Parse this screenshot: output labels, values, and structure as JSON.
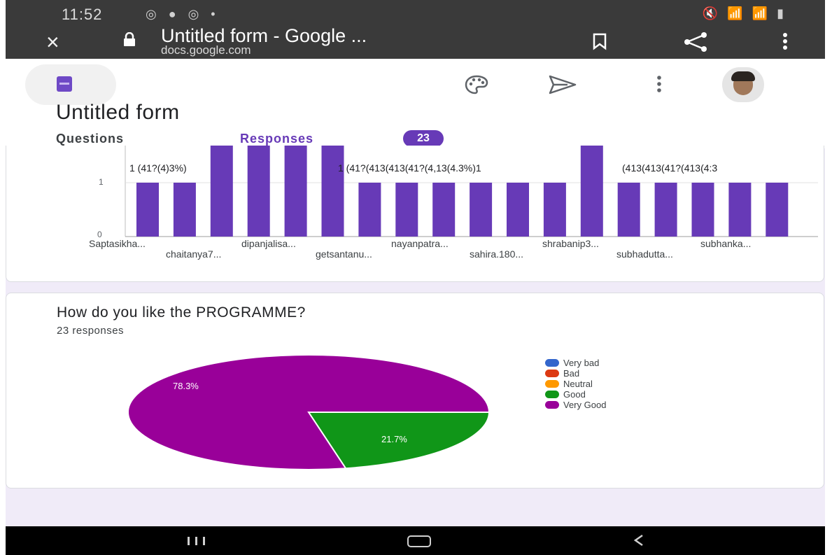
{
  "status_bar": {
    "time": "11:52",
    "left_icons": "◎ ● ◎ •",
    "right_icons": "🔇 📶 📶 ▮"
  },
  "browser": {
    "close_icon": "×",
    "page_title": "Untitled form - Google ...",
    "url": "docs.google.com"
  },
  "app": {
    "form_title": "Untitled form",
    "tabs": {
      "questions": "Questions",
      "responses": "Responses",
      "responses_count": "23"
    }
  },
  "bar_chart_labels": {
    "row1": [
      "Saptasikha...",
      "dipanjalisa...",
      "nayanpatra...",
      "shrabanip3...",
      "subhanka..."
    ],
    "row2": [
      "chaitanya7...",
      "getsantanu...",
      "sahira.180...",
      "subhadutta..."
    ],
    "top_labels": [
      "1 (41?(4)3%)",
      "1 (41?(413(413(41?(4,13(4.3%)1",
      "(413(413(41?(413(4:3"
    ]
  },
  "pie_card": {
    "question": "How do you like the PROGRAMME?",
    "responses": "23 responses"
  },
  "colors": {
    "purple": "#673ab7",
    "very_bad": "#3366cc",
    "bad": "#dc3912",
    "neutral": "#ff9900",
    "good": "#109618",
    "very_good": "#990099"
  },
  "chart_data": [
    {
      "type": "bar",
      "categories": [
        "Saptasikha...",
        "chaitanya7...",
        "dipanjalisa...",
        "getsantanu...",
        "nayanpatra...",
        "sahira.180...",
        "shrabanip3...",
        "subhadutta...",
        "subhanka..."
      ],
      "values_by_bar": [
        1,
        1,
        2,
        2,
        2,
        2,
        1,
        1,
        1,
        1,
        1,
        1,
        2,
        1,
        1,
        1,
        1,
        1
      ],
      "y_ticks": [
        "0",
        "1"
      ],
      "ylim": [
        0,
        1.2
      ]
    },
    {
      "type": "pie",
      "title": "How do you like the PROGRAMME?",
      "subtitle": "23 responses",
      "legend": [
        "Very bad",
        "Bad",
        "Neutral",
        "Good",
        "Very Good"
      ],
      "values": [
        0,
        0,
        0,
        21.7,
        78.3
      ],
      "labels": [
        "",
        "",
        "",
        "21.7%",
        "78.3%"
      ],
      "legend_position": "right"
    }
  ]
}
